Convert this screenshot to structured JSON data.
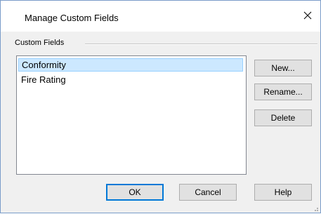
{
  "window": {
    "title": "Manage Custom Fields",
    "close_icon": "close-icon"
  },
  "group": {
    "label": "Custom Fields"
  },
  "list": {
    "items": [
      {
        "label": "Conformity",
        "selected": true
      },
      {
        "label": "Fire Rating",
        "selected": false
      }
    ]
  },
  "side_buttons": {
    "new_label": "New...",
    "rename_label": "Rename...",
    "delete_label": "Delete"
  },
  "footer_buttons": {
    "ok_label": "OK",
    "cancel_label": "Cancel",
    "help_label": "Help"
  },
  "colors": {
    "selection_bg": "#cce8ff",
    "selection_border": "#99d1ff",
    "default_button_border": "#0078d7",
    "dialog_bg": "#f0f0f0"
  }
}
